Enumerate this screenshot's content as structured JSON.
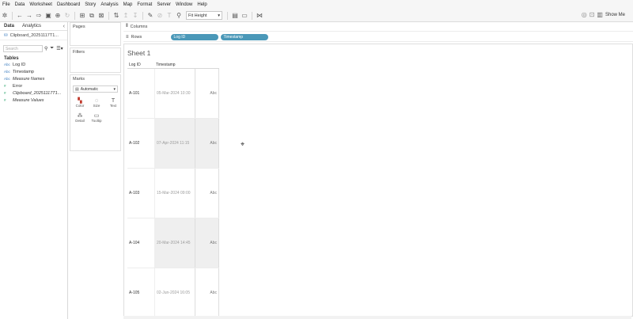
{
  "menu": [
    "File",
    "Data",
    "Worksheet",
    "Dashboard",
    "Story",
    "Analysis",
    "Map",
    "Format",
    "Server",
    "Window",
    "Help"
  ],
  "toolbar": {
    "fit": "Fit Height",
    "show_me": "Show Me"
  },
  "left_pane": {
    "tabs": [
      "Data",
      "Analytics"
    ],
    "datasource": "Clipboard_20251117T1...",
    "search_placeholder": "Search",
    "tables_title": "Tables",
    "fields": [
      {
        "type": "Abc",
        "name": "Log ID",
        "italic": false,
        "measure": false
      },
      {
        "type": "Abc",
        "name": "Timestamp",
        "italic": false,
        "measure": false
      },
      {
        "type": "Abc",
        "name": "Measure Names",
        "italic": true,
        "measure": false
      },
      {
        "type": "#",
        "name": "Error",
        "italic": false,
        "measure": true
      },
      {
        "type": "#",
        "name": "Clipboard_20251117T1...",
        "italic": true,
        "measure": true
      },
      {
        "type": "#",
        "name": "Measure Values",
        "italic": true,
        "measure": true
      }
    ]
  },
  "shelves": {
    "pages": "Pages",
    "filters": "Filters",
    "marks": "Marks",
    "mark_type": "Automatic",
    "mark_buttons": [
      "Color",
      "Size",
      "Text",
      "Detail",
      "Tooltip"
    ],
    "columns_label": "Columns",
    "rows_label": "Rows",
    "rows_pills": [
      "Log ID",
      "Timestamp"
    ]
  },
  "view": {
    "sheet_title": "Sheet 1",
    "headers": [
      "Log ID",
      "Timestamp"
    ],
    "rows": [
      {
        "id": "A-101",
        "ts": "05-Mar-2024 10:30",
        "val": "Abc"
      },
      {
        "id": "A-102",
        "ts": "07-Apr-2024 11:15",
        "val": "Abc"
      },
      {
        "id": "A-103",
        "ts": "15-Mar-2024 09:00",
        "val": "Abc"
      },
      {
        "id": "A-104",
        "ts": "20-Mar-2024 14:45",
        "val": "Abc"
      },
      {
        "id": "A-105",
        "ts": "02-Jun-2024 16:05",
        "val": "Abc"
      }
    ]
  }
}
